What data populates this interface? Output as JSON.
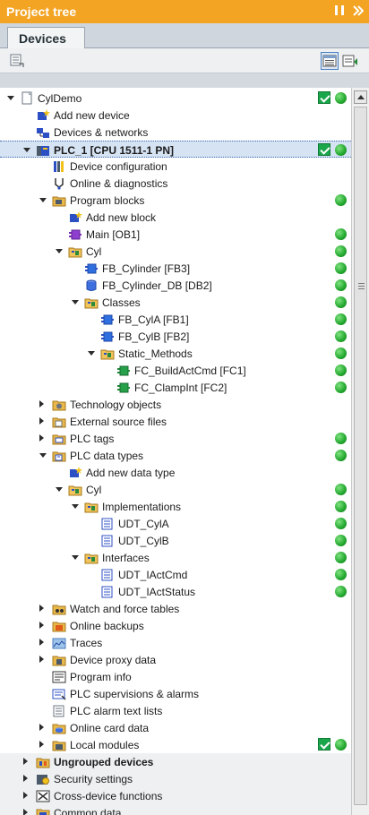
{
  "panel": {
    "title": "Project tree"
  },
  "tabs": [
    {
      "label": "Devices"
    }
  ],
  "toolbar": {
    "left_icon": "show-hide-columns-icon",
    "right_icons": [
      "overview-icon",
      "details-icon"
    ]
  },
  "status_colors": {
    "ok_green": "#22a72e",
    "check_green": "#1aa64b",
    "accent_orange": "#f4a423"
  },
  "tree": [
    {
      "label": "CylDemo",
      "level": 0,
      "toggle": "expanded",
      "icon": "project-icon",
      "check": true,
      "dot": true
    },
    {
      "label": "Add new device",
      "level": 1,
      "toggle": "none",
      "icon": "add-device-icon",
      "check": false,
      "dot": false
    },
    {
      "label": "Devices & networks",
      "level": 1,
      "toggle": "none",
      "icon": "devices-networks-icon",
      "check": false,
      "dot": false
    },
    {
      "label": "PLC_1 [CPU 1511-1 PN]",
      "level": 1,
      "toggle": "expanded",
      "icon": "plc-icon",
      "check": true,
      "dot": true,
      "selected": true,
      "bold": true
    },
    {
      "label": "Device configuration",
      "level": 2,
      "toggle": "none",
      "icon": "device-config-icon",
      "check": false,
      "dot": false
    },
    {
      "label": "Online & diagnostics",
      "level": 2,
      "toggle": "none",
      "icon": "online-diagnostics-icon",
      "check": false,
      "dot": false
    },
    {
      "label": "Program blocks",
      "level": 2,
      "toggle": "expanded",
      "icon": "folder-blocks-icon",
      "check": false,
      "dot": true
    },
    {
      "label": "Add new block",
      "level": 3,
      "toggle": "none",
      "icon": "add-block-icon",
      "check": false,
      "dot": false
    },
    {
      "label": "Main [OB1]",
      "level": 3,
      "toggle": "none",
      "icon": "ob-icon",
      "check": false,
      "dot": true
    },
    {
      "label": "Cyl",
      "level": 3,
      "toggle": "expanded",
      "icon": "group-folder-icon",
      "check": false,
      "dot": true
    },
    {
      "label": "FB_Cylinder [FB3]",
      "level": 4,
      "toggle": "none",
      "icon": "fb-icon",
      "check": false,
      "dot": true
    },
    {
      "label": "FB_Cylinder_DB [DB2]",
      "level": 4,
      "toggle": "none",
      "icon": "db-icon",
      "check": false,
      "dot": true
    },
    {
      "label": "Classes",
      "level": 4,
      "toggle": "expanded",
      "icon": "group-folder-icon",
      "check": false,
      "dot": true
    },
    {
      "label": "FB_CylA [FB1]",
      "level": 5,
      "toggle": "none",
      "icon": "fb-icon",
      "check": false,
      "dot": true
    },
    {
      "label": "FB_CylB [FB2]",
      "level": 5,
      "toggle": "none",
      "icon": "fb-icon",
      "check": false,
      "dot": true
    },
    {
      "label": "Static_Methods",
      "level": 5,
      "toggle": "expanded",
      "icon": "group-folder-icon",
      "check": false,
      "dot": true
    },
    {
      "label": "FC_BuildActCmd [FC1]",
      "level": 6,
      "toggle": "none",
      "icon": "fc-icon",
      "check": false,
      "dot": true
    },
    {
      "label": "FC_ClampInt [FC2]",
      "level": 6,
      "toggle": "none",
      "icon": "fc-icon",
      "check": false,
      "dot": true
    },
    {
      "label": "Technology objects",
      "level": 2,
      "toggle": "collapsed",
      "icon": "technology-objects-icon",
      "check": false,
      "dot": false
    },
    {
      "label": "External source files",
      "level": 2,
      "toggle": "collapsed",
      "icon": "external-sources-icon",
      "check": false,
      "dot": false
    },
    {
      "label": "PLC tags",
      "level": 2,
      "toggle": "collapsed",
      "icon": "plc-tags-icon",
      "check": false,
      "dot": true
    },
    {
      "label": "PLC data types",
      "level": 2,
      "toggle": "expanded",
      "icon": "plc-data-types-icon",
      "check": false,
      "dot": true
    },
    {
      "label": "Add new data type",
      "level": 3,
      "toggle": "none",
      "icon": "add-data-type-icon",
      "check": false,
      "dot": false
    },
    {
      "label": "Cyl",
      "level": 3,
      "toggle": "expanded",
      "icon": "group-folder-icon",
      "check": false,
      "dot": true
    },
    {
      "label": "Implementations",
      "level": 4,
      "toggle": "expanded",
      "icon": "group-folder-icon",
      "check": false,
      "dot": true
    },
    {
      "label": "UDT_CylA",
      "level": 5,
      "toggle": "none",
      "icon": "udt-icon",
      "check": false,
      "dot": true
    },
    {
      "label": "UDT_CylB",
      "level": 5,
      "toggle": "none",
      "icon": "udt-icon",
      "check": false,
      "dot": true
    },
    {
      "label": "Interfaces",
      "level": 4,
      "toggle": "expanded",
      "icon": "group-folder-icon",
      "check": false,
      "dot": true
    },
    {
      "label": "UDT_IActCmd",
      "level": 5,
      "toggle": "none",
      "icon": "udt-icon",
      "check": false,
      "dot": true
    },
    {
      "label": "UDT_IActStatus",
      "level": 5,
      "toggle": "none",
      "icon": "udt-icon",
      "check": false,
      "dot": true
    },
    {
      "label": "Watch and force tables",
      "level": 2,
      "toggle": "collapsed",
      "icon": "watch-tables-icon",
      "check": false,
      "dot": false
    },
    {
      "label": "Online backups",
      "level": 2,
      "toggle": "collapsed",
      "icon": "online-backups-icon",
      "check": false,
      "dot": false
    },
    {
      "label": "Traces",
      "level": 2,
      "toggle": "collapsed",
      "icon": "traces-icon",
      "check": false,
      "dot": false
    },
    {
      "label": "Device proxy data",
      "level": 2,
      "toggle": "collapsed",
      "icon": "device-proxy-icon",
      "check": false,
      "dot": false
    },
    {
      "label": "Program info",
      "level": 2,
      "toggle": "none",
      "icon": "program-info-icon",
      "check": false,
      "dot": false
    },
    {
      "label": "PLC supervisions & alarms",
      "level": 2,
      "toggle": "none",
      "icon": "supervisions-alarms-icon",
      "check": false,
      "dot": false
    },
    {
      "label": "PLC alarm text lists",
      "level": 2,
      "toggle": "none",
      "icon": "alarm-text-lists-icon",
      "check": false,
      "dot": false
    },
    {
      "label": "Online card data",
      "level": 2,
      "toggle": "collapsed",
      "icon": "online-card-icon",
      "check": false,
      "dot": false
    },
    {
      "label": "Local modules",
      "level": 2,
      "toggle": "collapsed",
      "icon": "local-modules-icon",
      "check": true,
      "dot": true
    },
    {
      "label": "Ungrouped devices",
      "level": 1,
      "toggle": "collapsed",
      "icon": "ungrouped-devices-icon",
      "check": false,
      "dot": false,
      "grouped": true,
      "bold": true
    },
    {
      "label": "Security settings",
      "level": 1,
      "toggle": "collapsed",
      "icon": "security-settings-icon",
      "check": false,
      "dot": false,
      "grouped": true
    },
    {
      "label": "Cross-device functions",
      "level": 1,
      "toggle": "collapsed",
      "icon": "cross-device-icon",
      "check": false,
      "dot": false,
      "grouped": true
    },
    {
      "label": "Common data",
      "level": 1,
      "toggle": "collapsed",
      "icon": "common-data-icon",
      "check": false,
      "dot": false,
      "grouped": true
    }
  ]
}
